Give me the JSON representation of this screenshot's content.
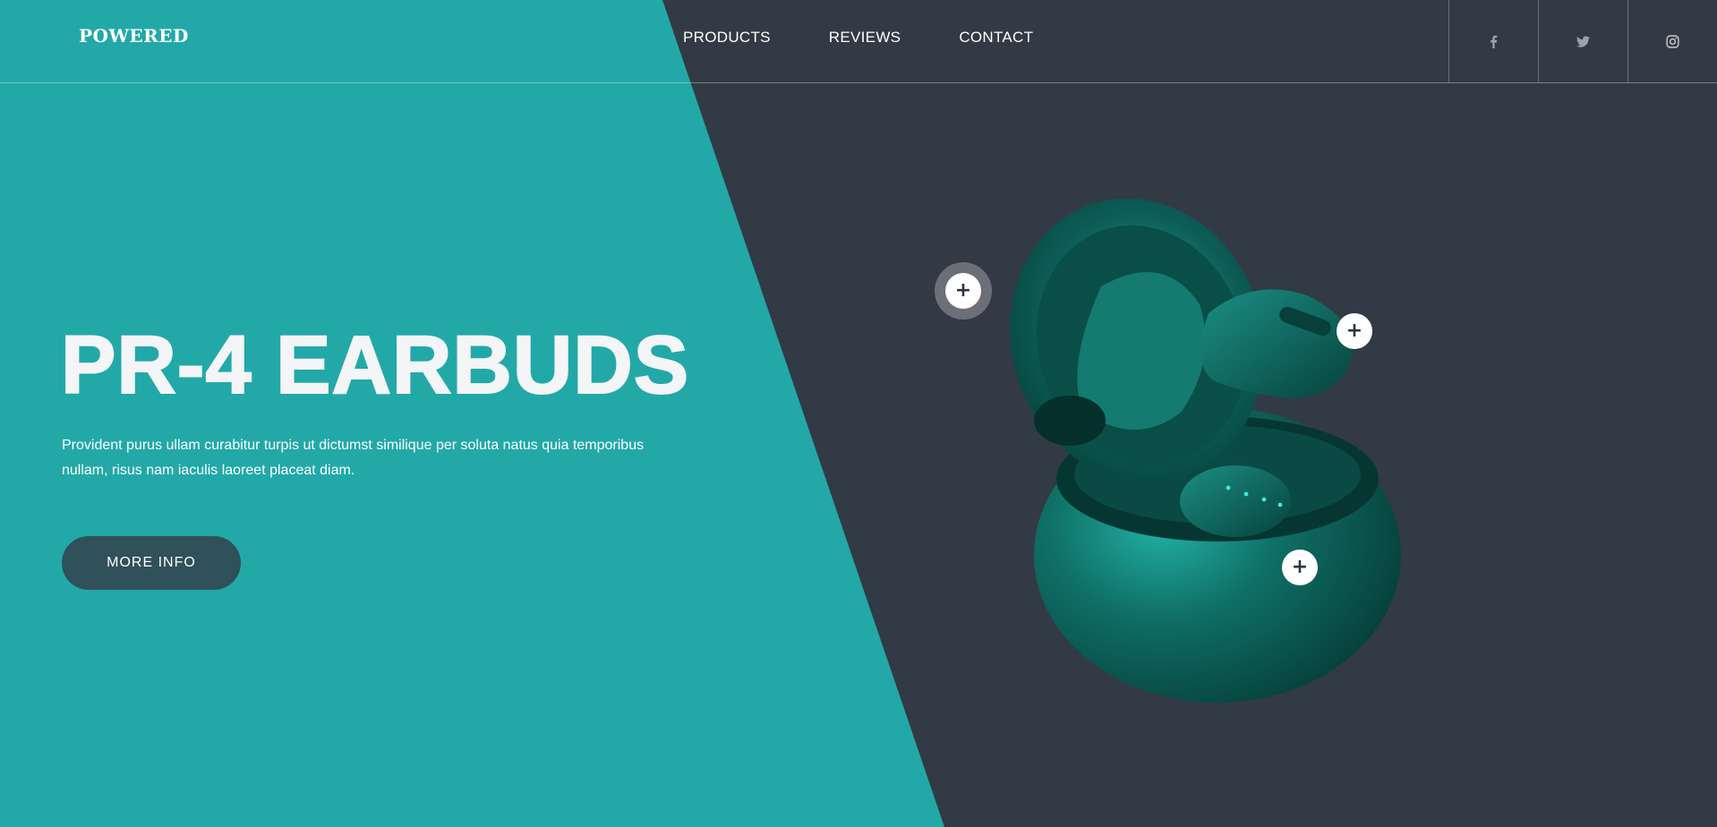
{
  "brand": {
    "logo": "POWERED"
  },
  "nav": {
    "items": [
      "PRODUCTS",
      "REVIEWS",
      "CONTACT"
    ]
  },
  "social": {
    "icons": [
      "facebook-icon",
      "twitter-icon",
      "instagram-icon"
    ]
  },
  "hero": {
    "title": "PR-4 EARBUDS",
    "description": "Provident purus ullam curabitur turpis ut dictumst similique per soluta natus quia temporibus nullam, risus nam iaculis laoreet placeat diam.",
    "button_label": "MORE INFO"
  },
  "hotspots": {
    "symbol": "+"
  },
  "colors": {
    "teal": "#23a8a8",
    "dark": "#323a45",
    "button": "#30505a",
    "product": "#0f6f66"
  }
}
